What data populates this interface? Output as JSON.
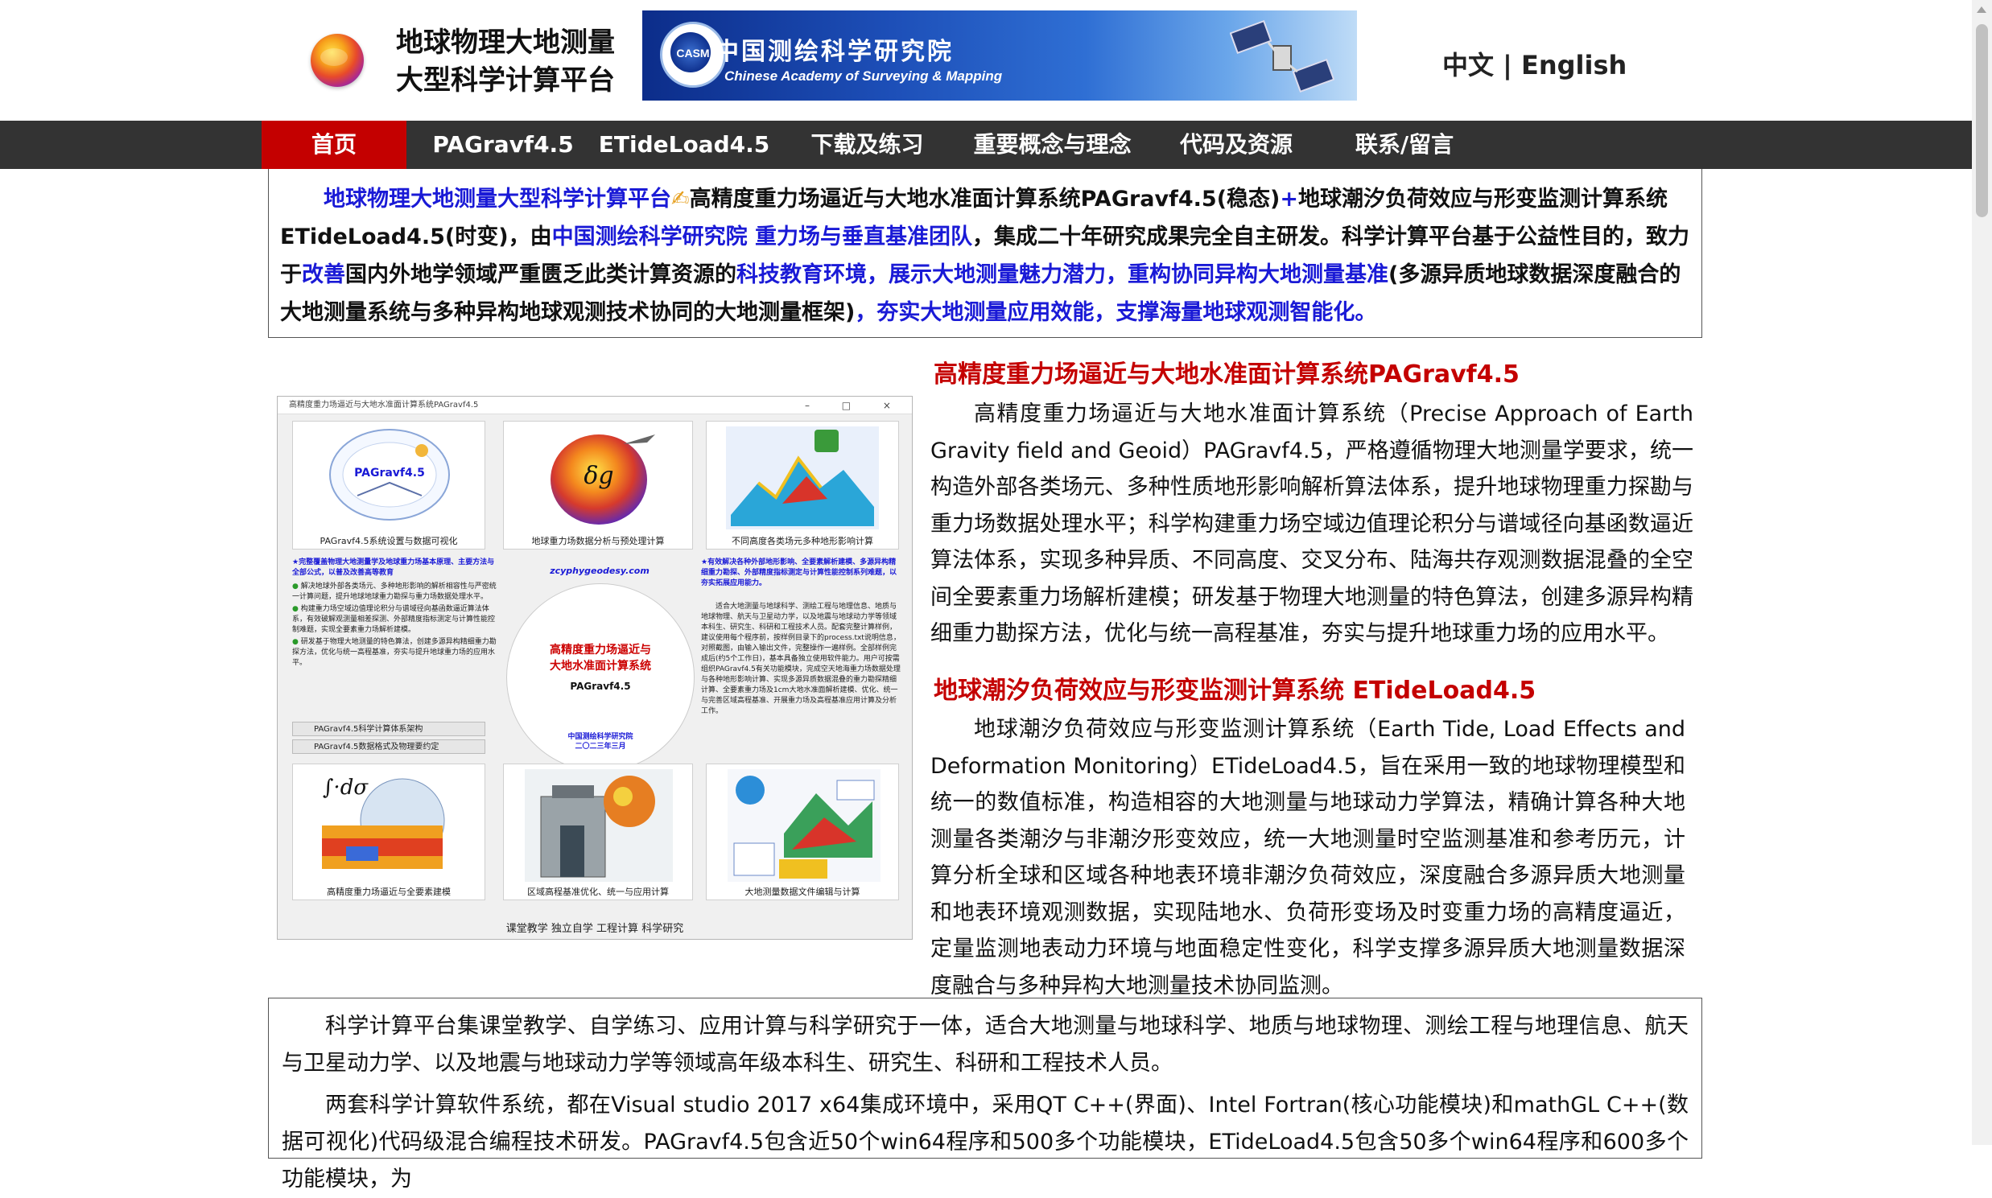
{
  "header": {
    "title_line1": "地球物理大地测量",
    "title_line2": "大型科学计算平台",
    "banner_emblem": "CASM",
    "banner_cn": "中国测绘科学研究院",
    "banner_en": "Chinese Academy of Surveying & Mapping",
    "lang_cn": "中文",
    "lang_sep": " | ",
    "lang_en": "English"
  },
  "nav": {
    "items": [
      "首页",
      "PAGravf4.5",
      "ETideLoad4.5",
      "下载及练习",
      "重要概念与理念",
      "代码及资源",
      "联系/留言"
    ],
    "active": "首页"
  },
  "intro": {
    "p1": "地球物理大地测量大型科学计算平台",
    "emoji": "✍",
    "p2": "高精度重力场逼近与大地水准面计算系统PAGravf4.5(稳态)",
    "p3": "+",
    "p4": "地球潮汐负荷效应与形变监测计算系统ETideLoad4.5(时变)，由",
    "p5": "中国测绘科学研究院 重力场与垂直基准团队",
    "p6": "，集成二十年研究成果完全自主研发。科学计算平台基于公益性目的，致力于",
    "p7": "改善",
    "p8": "国内外地学领域严重匮乏此类计算资源的",
    "p9": "科技教育环境，展示大地测量魅力潜力，重构协同异构大地测量基准",
    "p10": "(多源异质地球数据深度融合的大地测量系统与多种异构地球观测技术协同的大地测量框架)",
    "p11": "，夯实大地测量应用效能，支撑海量地球观测智能化。"
  },
  "app_screenshot": {
    "window_title": "高精度重力场逼近与大地水准面计算系统PAGravf4.5",
    "window_controls": "–  □  ×",
    "tile1_caption": "PAGravf4.5系统设置与数据可视化",
    "tile1_logo": "PAGravf4.5",
    "tile2_caption": "地球重力场数据分析与预处理计算",
    "tile2_symbol": "δg",
    "tile3_caption": "不同高度各类场元多种地形影响计算",
    "left_text_head": "★完整覆盖物理大地测量学及地球重力场基本原理、主要方法与全部公式，以普及改善高等教育",
    "left_text_b1": "解决地球外部各类场元、多种地形影响的解析相容性与严密统一计算问题，提升地球地球重力勘探与重力场数据处理水平。",
    "left_text_b2": "构建重力场空域边值理论积分与谱域径向基函数逼近算法体系，有效破解观测量相差探测、外部精度指标测定与计算性能控制难题，实现全要素重力场解析建模。",
    "left_text_b3": "研发基于物理大地测量的特色算法，创建多源异构精细重力勘探方法，优化与统一高程基准，夯实与提升地球重力场的应用水平。",
    "btn1": "PAGravf4.5科学计算体系架构",
    "btn2": "PAGravf4.5数据格式及物理要约定",
    "center_site": "zcyphygeodesy.com",
    "center_t1": "高精度重力场逼近与",
    "center_t2": "大地水准面计算系统",
    "center_t3": "PAGravf4.5",
    "center_t4": "中国测绘科学研究院",
    "center_t5": "二〇二三年三月",
    "right_text_head": "★有效解决各种外部地形影响、全要素解析建模、多源异构精细重力勘探、外部精度指标测定与计算性能控制系列难题，以夯实拓展应用能力。",
    "right_text_body": "适合大地测量与地球科学、测绘工程与地理信息、地质与地球物理、航天与卫星动力学，以及地震与地球动力学等领域本科生、研究生、科研和工程技术人员。配套完整计算样例，建议使用每个程序前，按样例目录下的process.txt说明信息，对照截图，由输入输出文件，完整操作一遍样例。全部样例完成后(约5个工作日)，基本具备独立使用软件能力。用户可按需组织PAGravf4.5有关功能模块，完成空天地海重力场数据处理与各种地形影响计算、实现多源异质数据混叠的重力勘探精细计算、全要素重力场及1cm大地水准面解析建模、优化、统一与完善区域高程基准、开展重力场及高程基准应用计算及分析工作。",
    "tile4_caption": "高精度重力场逼近与全要素建模",
    "tile4_symbol": "∫·dσ",
    "tile5_caption": "区域高程基准优化、统一与应用计算",
    "tile6_caption": "大地测量数据文件编辑与计算",
    "tabs": "课堂教学   独立自学   工程计算   科学研究"
  },
  "pagravf": {
    "title": "高精度重力场逼近与大地水准面计算系统PAGravf4.5",
    "body": "高精度重力场逼近与大地水准面计算系统（Precise Approach of Earth Gravity field and Geoid）PAGravf4.5，严格遵循物理大地测量学要求，统一构造外部各类场元、多种性质地形影响解析算法体系，提升地球物理重力探勘与重力场数据处理水平；科学构建重力场空域边值理论积分与谱域径向基函数逼近算法体系，实现多种异质、不同高度、交叉分布、陆海共存观测数据混叠的全空间全要素重力场解析建模；研发基于物理大地测量的特色算法，创建多源异构精细重力勘探方法，优化与统一高程基准，夯实与提升地球重力场的应用水平。"
  },
  "etideload": {
    "title": "地球潮汐负荷效应与形变监测计算系统 ETideLoad4.5",
    "body": "地球潮汐负荷效应与形变监测计算系统（Earth Tide, Load Effects and Deformation Monitoring）ETideLoad4.5，旨在采用一致的地球物理模型和统一的数值标准，构造相容的大地测量与地球动力学算法，精确计算各种大地测量各类潮汐与非潮汐形变效应，统一大地测量时空监测基准和参考历元，计算分析全球和区域各种地表环境非潮汐负荷效应，深度融合多源异质大地测量和地表环境观测数据，实现陆地水、负荷形变场及时变重力场的高精度逼近，定量监测地表动力环境与地面稳定性变化，科学支撑多源异质大地测量数据深度融合与多种异构大地测量技术协同监测。"
  },
  "bottom": {
    "p1": "科学计算平台集课堂教学、自学练习、应用计算与科学研究于一体，适合大地测量与地球科学、地质与地球物理、测绘工程与地理信息、航天与卫星动力学、以及地震与地球动力学等领域高年级本科生、研究生、科研和工程技术人员。",
    "p2": "两套科学计算软件系统，都在Visual studio 2017 x64集成环境中，采用QT C++(界面)、Intel Fortran(核心功能模块)和mathGL C++(数据可视化)代码级混合编程技术研发。PAGravf4.5包含近50个win64程序和500多个功能模块，ETideLoad4.5包含50多个win64程序和600多个功能模块，为"
  },
  "colors": {
    "nav_bg": "#333333",
    "nav_active": "#c40000",
    "accent_blue": "#1a1ad6",
    "section_red": "#c40000"
  }
}
